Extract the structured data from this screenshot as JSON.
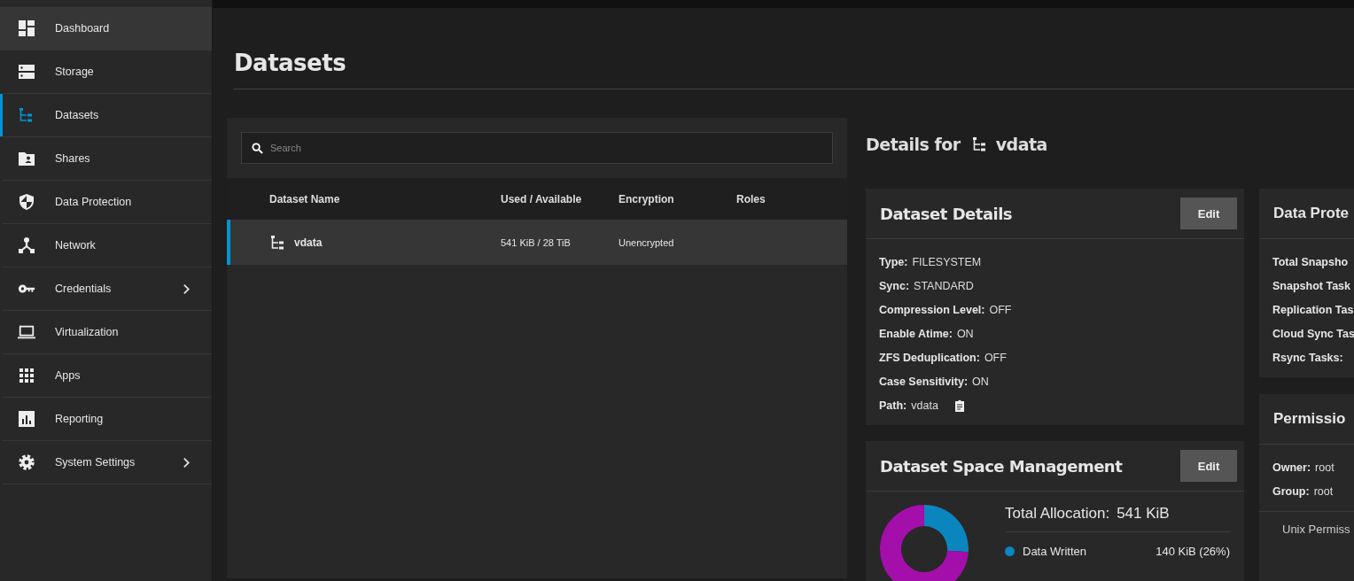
{
  "sidebar": {
    "items": [
      {
        "label": "Dashboard",
        "kind": "dashboard",
        "selected": false,
        "hovered": true,
        "has_submenu": false
      },
      {
        "label": "Storage",
        "kind": "storage",
        "selected": false,
        "hovered": false,
        "has_submenu": false
      },
      {
        "label": "Datasets",
        "kind": "datasets",
        "selected": true,
        "hovered": false,
        "has_submenu": false
      },
      {
        "label": "Shares",
        "kind": "shares",
        "selected": false,
        "hovered": false,
        "has_submenu": false
      },
      {
        "label": "Data Protection",
        "kind": "shield",
        "selected": false,
        "hovered": false,
        "has_submenu": false
      },
      {
        "label": "Network",
        "kind": "network",
        "selected": false,
        "hovered": false,
        "has_submenu": false
      },
      {
        "label": "Credentials",
        "kind": "key",
        "selected": false,
        "hovered": false,
        "has_submenu": true
      },
      {
        "label": "Virtualization",
        "kind": "laptop",
        "selected": false,
        "hovered": false,
        "has_submenu": false
      },
      {
        "label": "Apps",
        "kind": "apps",
        "selected": false,
        "hovered": false,
        "has_submenu": false
      },
      {
        "label": "Reporting",
        "kind": "reporting",
        "selected": false,
        "hovered": false,
        "has_submenu": false
      },
      {
        "label": "System Settings",
        "kind": "gear",
        "selected": false,
        "hovered": false,
        "has_submenu": true
      }
    ]
  },
  "page": {
    "title": "Datasets"
  },
  "search": {
    "placeholder": "Search"
  },
  "table": {
    "columns": [
      "Dataset Name",
      "Used / Available",
      "Encryption",
      "Roles"
    ],
    "rows": [
      {
        "name": "vdata",
        "used_available": "541 KiB / 28 TiB",
        "encryption": "Unencrypted",
        "selected": true
      }
    ]
  },
  "details": {
    "heading": "Details for",
    "dataset": "vdata"
  },
  "dataset_details": {
    "title": "Dataset Details",
    "button": "Edit",
    "fields": [
      {
        "label": "Type:",
        "value": "FILESYSTEM",
        "copyable": false
      },
      {
        "label": "Sync:",
        "value": "STANDARD",
        "copyable": false
      },
      {
        "label": "Compression Level:",
        "value": "OFF",
        "copyable": false
      },
      {
        "label": "Enable Atime:",
        "value": "ON",
        "copyable": false
      },
      {
        "label": "ZFS Deduplication:",
        "value": "OFF",
        "copyable": false
      },
      {
        "label": "Case Sensitivity:",
        "value": "ON",
        "copyable": false
      },
      {
        "label": "Path:",
        "value": "vdata",
        "copyable": true
      }
    ]
  },
  "space_management": {
    "title": "Dataset Space Management",
    "button": "Edit",
    "total_label": "Total Allocation:",
    "total_value": "541 KiB",
    "legend": [
      {
        "label": "Data Written",
        "value": "140 KiB (26%)",
        "color": "#0a85bd"
      }
    ],
    "chart_data": {
      "type": "donut",
      "values": [
        26,
        74
      ],
      "colors": [
        "#0a85bd",
        "#a40eaa"
      ]
    }
  },
  "data_protection": {
    "title": "Data Prote",
    "fields": [
      "Total Snapsho",
      "Snapshot Task",
      "Replication Tas",
      "Cloud Sync Tas",
      "Rsync Tasks:"
    ]
  },
  "permissions": {
    "title": "Permissio",
    "fields": [
      {
        "label": "Owner:",
        "value": "root"
      },
      {
        "label": "Group:",
        "value": "root"
      }
    ],
    "section": "Unix Permiss"
  }
}
